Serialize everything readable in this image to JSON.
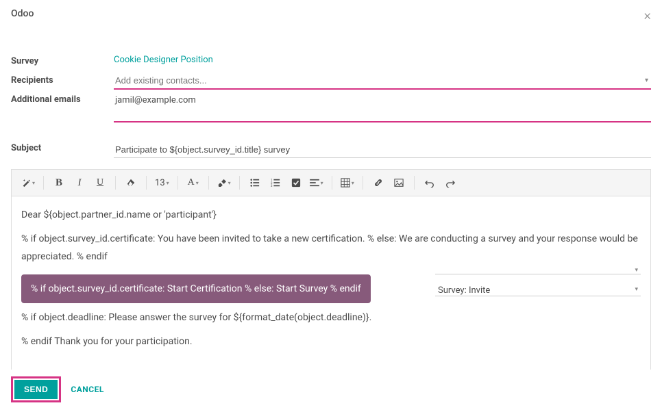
{
  "modal": {
    "title": "Odoo",
    "close": "×"
  },
  "form": {
    "survey_label": "Survey",
    "survey_value": "Cookie Designer Position",
    "recipients_label": "Recipients",
    "recipients_placeholder": "Add existing contacts...",
    "additional_emails_label": "Additional emails",
    "additional_emails_value": "jamil@example.com",
    "subject_label": "Subject",
    "subject_value": "Participate to ${object.survey_id.title} survey"
  },
  "toolbar": {
    "font_size": "13"
  },
  "editor": {
    "greeting": "Dear ${object.partner_id.name or 'participant'}",
    "body1": "% if object.survey_id.certificate: You have been invited to take a new certification. % else: We are conducting a survey and your response would be appreciated. % endif",
    "button_text": "% if object.survey_id.certificate: Start Certification % else: Start Survey % endif",
    "body2": "% if object.deadline: Please answer the survey for ${format_date(object.deadline)}.",
    "body3": "% endif Thank you for your participation.",
    "template_select": "Survey: Invite"
  },
  "footer": {
    "send": "SEND",
    "cancel": "CANCEL"
  }
}
